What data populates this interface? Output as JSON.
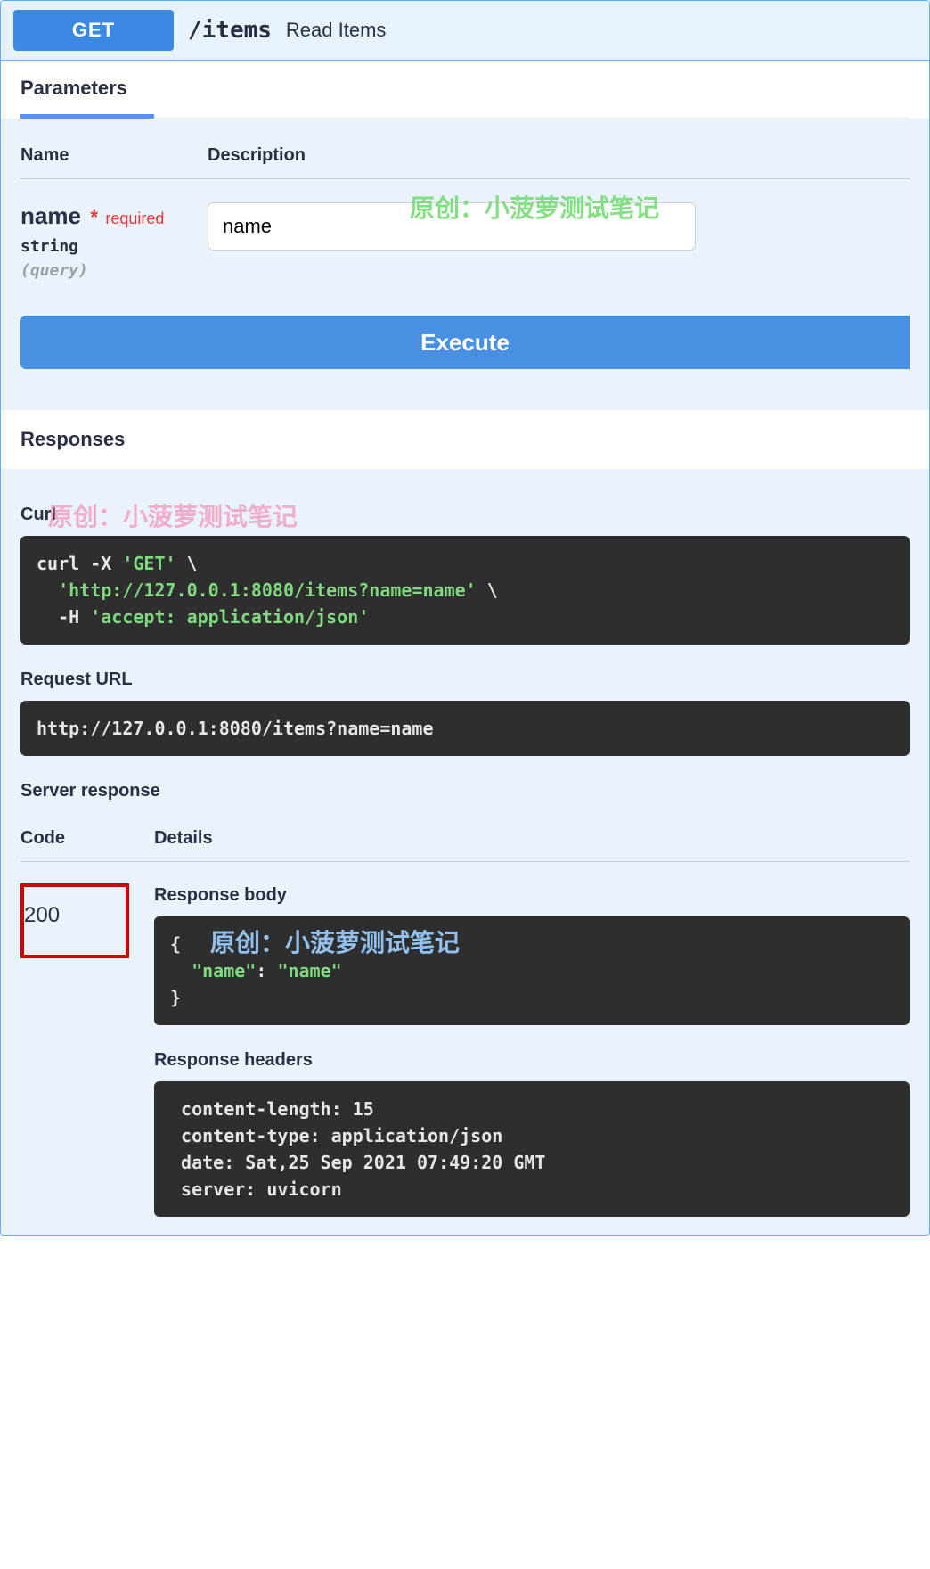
{
  "header": {
    "method": "GET",
    "path": "/items",
    "summary": "Read Items"
  },
  "tabs": {
    "parameters": "Parameters"
  },
  "param_table": {
    "col_name": "Name",
    "col_desc": "Description"
  },
  "param": {
    "name": "name",
    "required_star": "*",
    "required_text": "required",
    "type": "string",
    "in": "(query)",
    "value": "name",
    "placeholder": "name"
  },
  "buttons": {
    "execute": "Execute"
  },
  "responses": {
    "heading": "Responses",
    "curl_label": "Curl",
    "curl_plain_1": "curl -X ",
    "curl_method": "'GET'",
    "curl_plain_1b": " \\",
    "curl_plain_2a": "  ",
    "curl_url": "'http://127.0.0.1:8080/items?name=name'",
    "curl_plain_2b": " \\",
    "curl_plain_3a": "  -H ",
    "curl_header": "'accept: application/json'",
    "request_url_label": "Request URL",
    "request_url": "http://127.0.0.1:8080/items?name=name",
    "server_response_label": "Server response",
    "code_label": "Code",
    "details_label": "Details",
    "status_code": "200",
    "response_body_label": "Response body",
    "response_body_l1": "{",
    "response_body_l2a": "  ",
    "response_body_key": "\"name\"",
    "response_body_l2b": ": ",
    "response_body_val": "\"name\"",
    "response_body_l3": "}",
    "response_headers_label": "Response headers",
    "response_headers": " content-length: 15 \n content-type: application/json \n date: Sat,25 Sep 2021 07:49:20 GMT \n server: uvicorn "
  },
  "watermarks": {
    "text": "原创：小菠萝测试笔记"
  }
}
